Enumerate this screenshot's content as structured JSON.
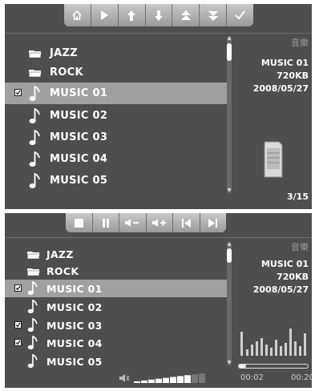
{
  "screen1": {
    "header_title": "音樂",
    "folders": [
      "JAZZ",
      "ROCK"
    ],
    "tracks": [
      "MUSIC 01",
      "MUSIC 02",
      "MUSIC 03",
      "MUSIC 04",
      "MUSIC 05"
    ],
    "selected_track": "MUSIC 01",
    "checked_tracks": [
      "MUSIC 01"
    ],
    "info": {
      "name": "MUSIC 01",
      "size": "720KB",
      "date": "2008/05/27"
    },
    "page_indicator": "3/15",
    "toolbar_icons": [
      "home-icon",
      "play-icon",
      "up-arrow-icon",
      "down-arrow-icon",
      "page-up-icon",
      "page-down-icon",
      "checkmark-icon"
    ]
  },
  "screen2": {
    "header_title": "音樂",
    "folders": [
      "JAZZ",
      "ROCK"
    ],
    "tracks": [
      "MUSIC 01",
      "MUSIC 02",
      "MUSIC 03",
      "MUSIC 04",
      "MUSIC 05"
    ],
    "selected_track": "MUSIC 01",
    "checked_tracks": [
      "MUSIC 01",
      "MUSIC 03",
      "MUSIC 04"
    ],
    "info": {
      "name": "MUSIC 01",
      "size": "720KB",
      "date": "2008/05/27"
    },
    "elapsed": "00:02",
    "total": "00:20",
    "progress_fraction": 0.1,
    "volume_level": 0.8,
    "toolbar_icons": [
      "stop-icon",
      "pause-icon",
      "volume-down-icon",
      "volume-up-icon",
      "previous-track-icon",
      "next-track-icon"
    ]
  },
  "colors": {
    "background": "#4e4e4e",
    "selection": "#a0a0a0",
    "toolbar": "#b4b4b4"
  }
}
